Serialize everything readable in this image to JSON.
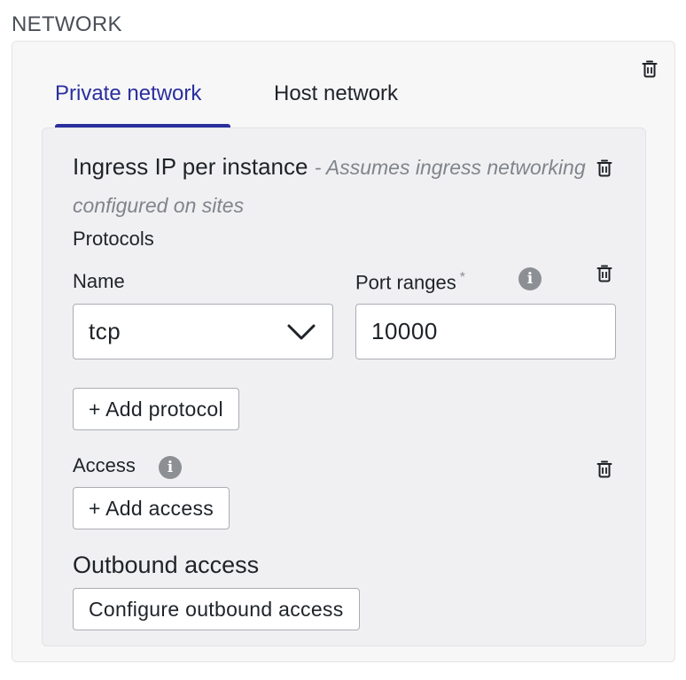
{
  "section": {
    "title": "NETWORK"
  },
  "tabs": [
    {
      "label": "Private network",
      "active": true
    },
    {
      "label": "Host network",
      "active": false
    }
  ],
  "ingress": {
    "title": "Ingress IP per instance",
    "note": "- Assumes ingress networking configured on sites"
  },
  "protocols": {
    "heading": "Protocols",
    "name_label": "Name",
    "port_label": "Port ranges",
    "required_marker": "*",
    "name_value": "tcp",
    "port_value": "10000",
    "add_button": "+ Add protocol"
  },
  "access": {
    "heading": "Access",
    "add_button": "+ Add access"
  },
  "outbound": {
    "heading": "Outbound access",
    "configure_button": "Configure outbound access"
  },
  "icons": {
    "delete": "trash-icon",
    "info": "info-icon",
    "dropdown": "chevron-down-icon"
  },
  "colors": {
    "accent": "#2b2f9e",
    "info_icon": "#8c8f94",
    "muted_text": "#80848b"
  }
}
